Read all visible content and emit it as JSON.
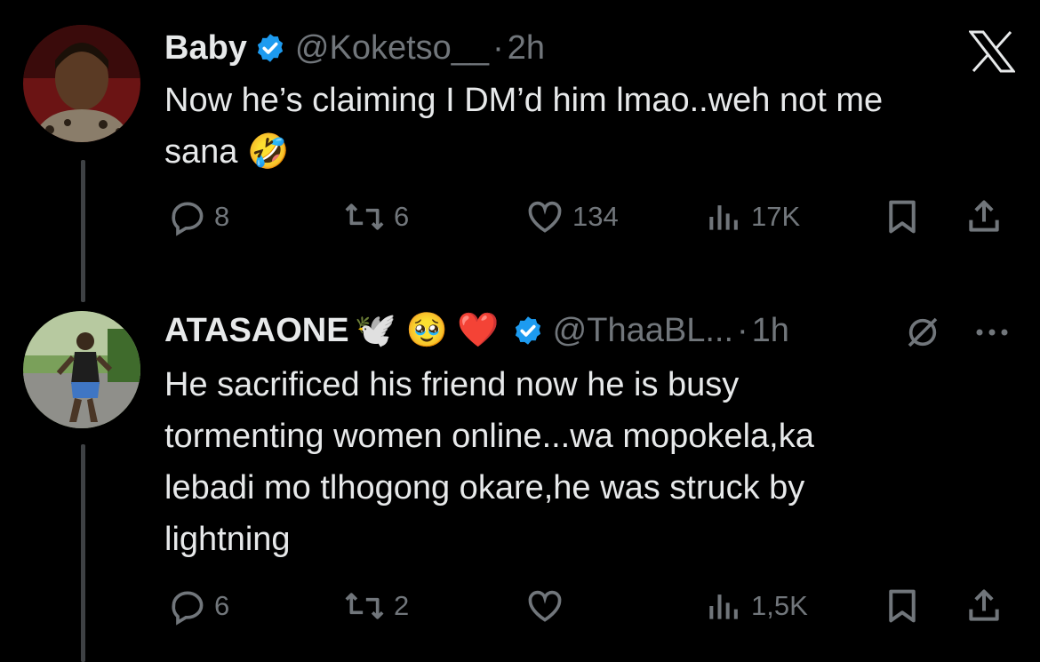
{
  "tweets": [
    {
      "name": "Baby",
      "handle": "@Koketso__",
      "separator": "·",
      "time": "2h",
      "text_lines": [
        "Now he’s claiming I DM’d him lmao..weh not me",
        "sana 🤣"
      ],
      "replies": "8",
      "retweets": "6",
      "likes": "134",
      "views": "17K"
    },
    {
      "name": "ATASAONE",
      "name_emojis": "🕊️ 🥹 ❤️",
      "handle": "@ThaaBL...",
      "separator": "·",
      "time": "1h",
      "text_lines": [
        "He sacrificed his friend now he is busy",
        "tormenting women online...wa mopokela,ka",
        "lebadi mo tlhogong okare,he was struck by",
        "lightning"
      ],
      "replies": "6",
      "retweets": "2",
      "likes": "",
      "views": "1,5K"
    }
  ],
  "colors": {
    "background": "#000000",
    "text": "#e7e9ea",
    "muted": "#71767b",
    "verified": "#1d9bf0",
    "thread_line": "#3e4144"
  },
  "icons": [
    "x-logo-icon",
    "verified-badge-icon",
    "reply-icon",
    "retweet-icon",
    "like-icon",
    "views-icon",
    "bookmark-icon",
    "share-icon",
    "grok-icon",
    "more-icon"
  ]
}
